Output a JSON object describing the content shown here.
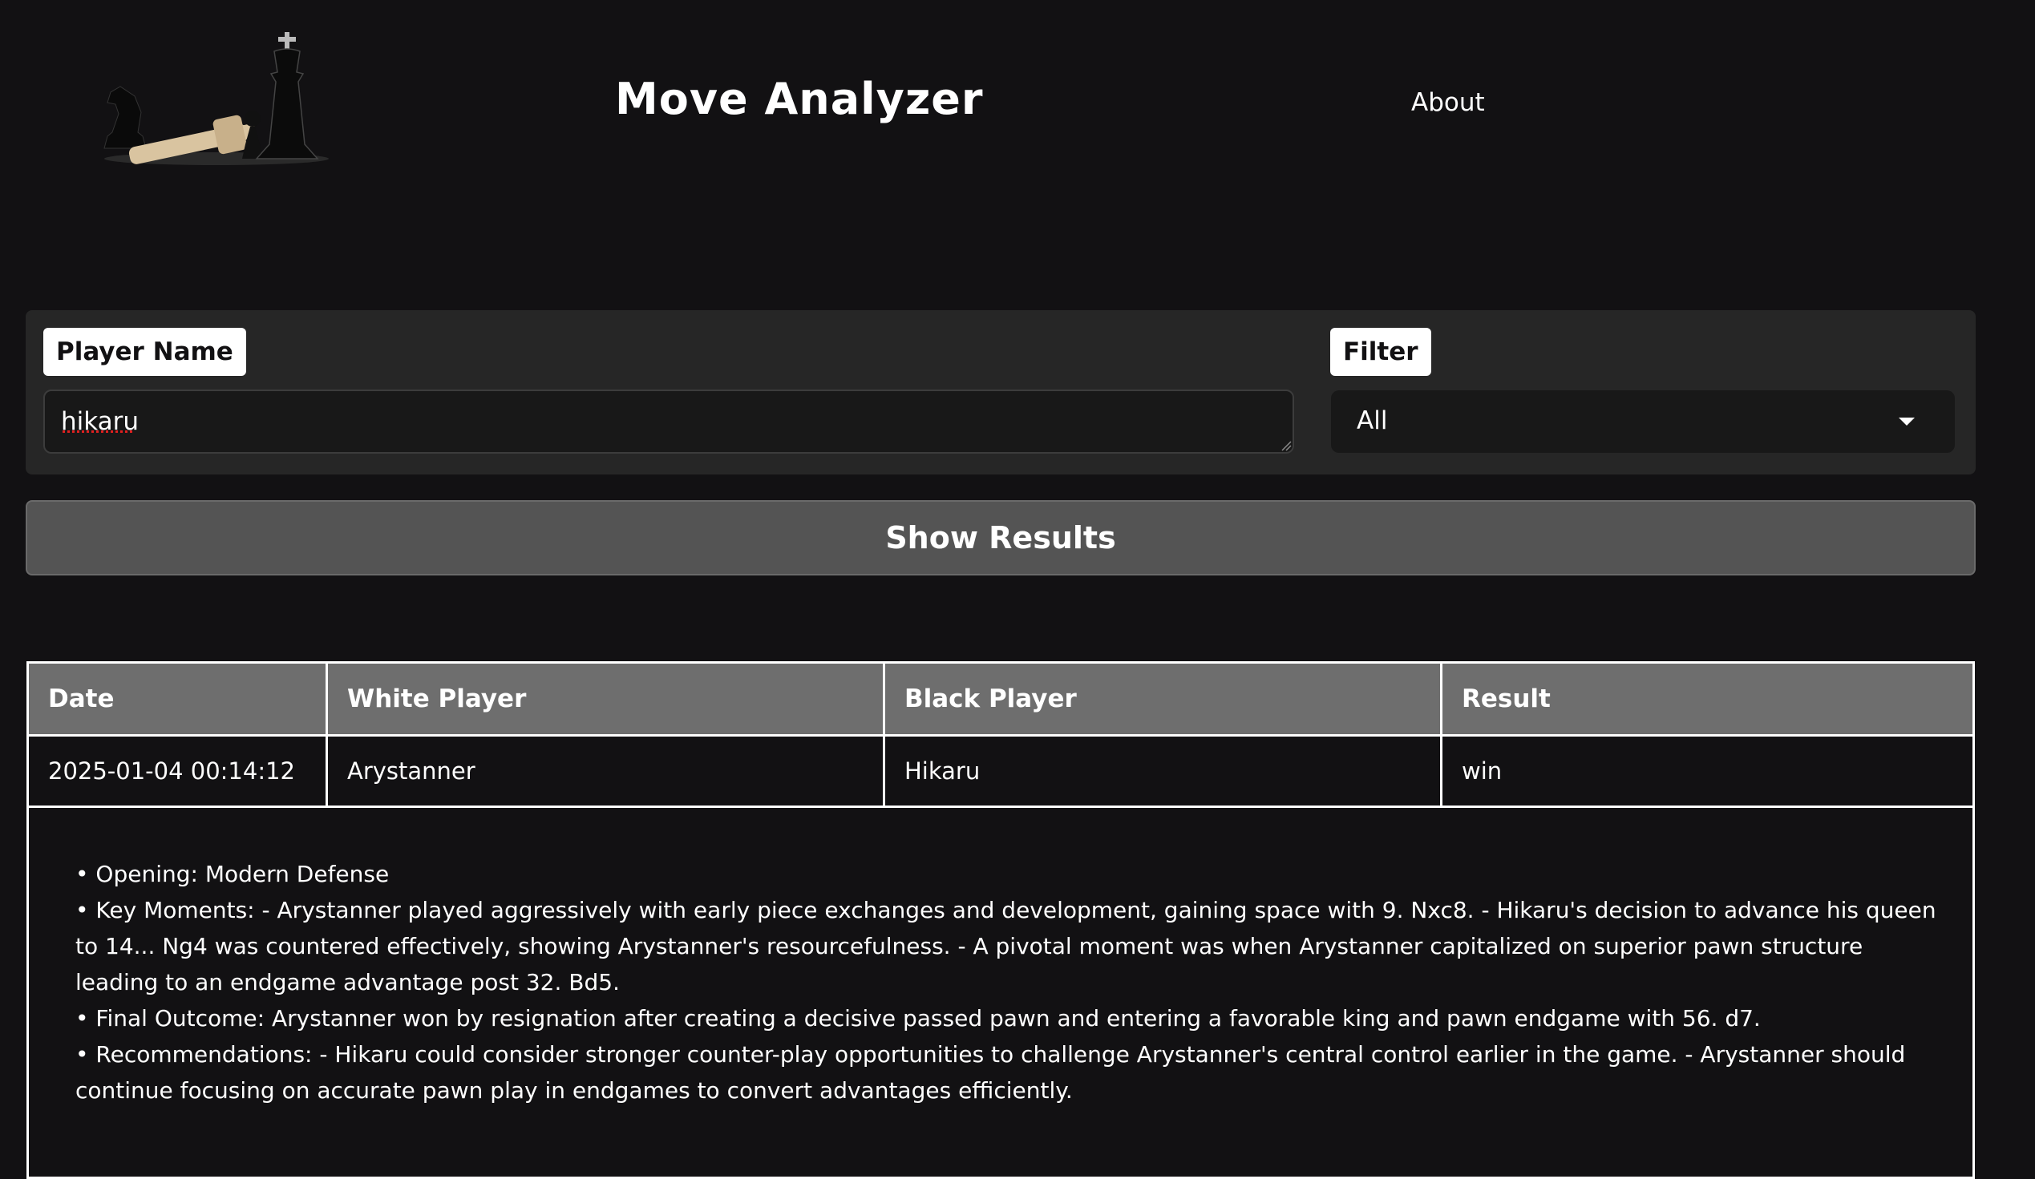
{
  "header": {
    "title": "Move Analyzer",
    "nav": [
      {
        "label": "About"
      }
    ]
  },
  "form": {
    "player_label": "Player Name",
    "player_value": "hikaru",
    "filter_label": "Filter",
    "filter_selected": "All"
  },
  "actions": {
    "show_results": "Show Results"
  },
  "table": {
    "columns": [
      "Date",
      "White Player",
      "Black Player",
      "Result"
    ],
    "rows": [
      {
        "date": "2025-01-04 00:14:12",
        "white": "Arystanner",
        "black": "Hikaru",
        "result": "win"
      }
    ],
    "analysis": [
      "• Opening: Modern Defense",
      "• Key Moments: - Arystanner played aggressively with early piece exchanges and development, gaining space with 9. Nxc8. - Hikaru's decision to advance his queen to 14... Ng4 was countered effectively, showing Arystanner's resourcefulness. - A pivotal moment was when Arystanner capitalized on superior pawn structure leading to an endgame advantage post 32. Bd5.",
      "• Final Outcome: Arystanner won by resignation after creating a decisive passed pawn and entering a favorable king and pawn endgame with 56. d7.",
      "• Recommendations: - Hikaru could consider stronger counter-play opportunities to challenge Arystanner's central control earlier in the game. - Arystanner should continue focusing on accurate pawn play in endgames to convert advantages efficiently."
    ]
  },
  "colors": {
    "background": "#121113",
    "panel": "#262626",
    "button": "#545454",
    "table_header": "#6e6e6e"
  },
  "icons": {
    "logo": "chess-pieces-logo",
    "dropdown": "caret-down-icon",
    "grip": "resize-grip-icon"
  }
}
